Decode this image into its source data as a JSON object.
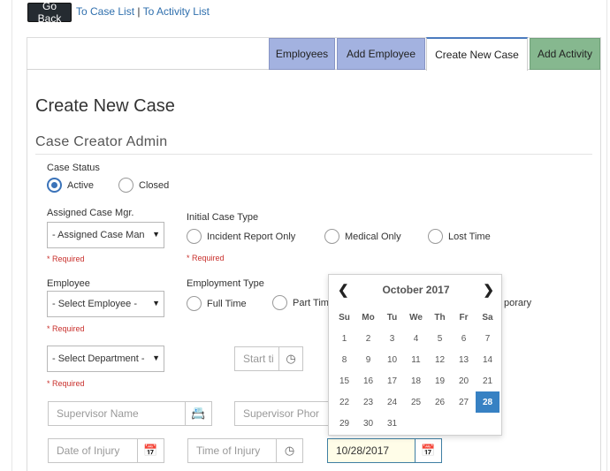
{
  "nav": {
    "go_back": "Go Back",
    "case_list": "To Case List",
    "sep": "|",
    "activity_list": "To Activity List"
  },
  "tabs": {
    "employees": "Employees",
    "add_employee": "Add Employee",
    "create_new_case": "Create New Case",
    "add_activity": "Add Activity"
  },
  "page": {
    "title": "Create New Case",
    "section": "Case Creator Admin"
  },
  "form": {
    "case_status": {
      "label": "Case Status",
      "options": [
        "Active",
        "Closed"
      ],
      "selected": "Active"
    },
    "assigned_mgr": {
      "label": "Assigned Case Mgr.",
      "value": "- Assigned Case Man",
      "required": "* Required"
    },
    "initial_case_type": {
      "label": "Initial Case Type",
      "options": [
        "Incident Report Only",
        "Medical Only",
        "Lost Time"
      ],
      "required": "* Required"
    },
    "employee": {
      "label": "Employee",
      "value": "- Select Employee -",
      "required": "* Required"
    },
    "employment_type": {
      "label": "Employment Type",
      "options": [
        "Full Time",
        "Part Tim",
        "porary"
      ]
    },
    "department": {
      "value": "- Select Department -",
      "required": "* Required"
    },
    "start_time": {
      "placeholder": "Start ti"
    },
    "supervisor_name": {
      "placeholder": "Supervisor Name"
    },
    "supervisor_phone": {
      "placeholder": "Supervisor Phor"
    },
    "date_of_injury": {
      "placeholder": "Date of Injury"
    },
    "time_of_injury": {
      "placeholder": "Time of Injury"
    },
    "date_value": {
      "value": "10/28/2017"
    }
  },
  "calendar": {
    "prev": "❮",
    "next": "❯",
    "month_year": "October 2017",
    "weekdays": [
      "Su",
      "Mo",
      "Tu",
      "We",
      "Th",
      "Fr",
      "Sa"
    ],
    "weeks": [
      [
        "1",
        "2",
        "3",
        "4",
        "5",
        "6",
        "7"
      ],
      [
        "8",
        "9",
        "10",
        "11",
        "12",
        "13",
        "14"
      ],
      [
        "15",
        "16",
        "17",
        "18",
        "19",
        "20",
        "21"
      ],
      [
        "22",
        "23",
        "24",
        "25",
        "26",
        "27",
        "28"
      ],
      [
        "29",
        "30",
        "31",
        "",
        "",
        "",
        ""
      ]
    ],
    "selected_day": "28"
  },
  "icons": {
    "calendar": "calendar-icon",
    "clock": "clock-icon",
    "id_card": "id-card-icon",
    "chevron": "chevron-down-icon"
  },
  "colors": {
    "tab_blue": "#a3b2e0",
    "tab_green": "#86b88f",
    "accent": "#3781c3",
    "required": "#c9302c"
  }
}
